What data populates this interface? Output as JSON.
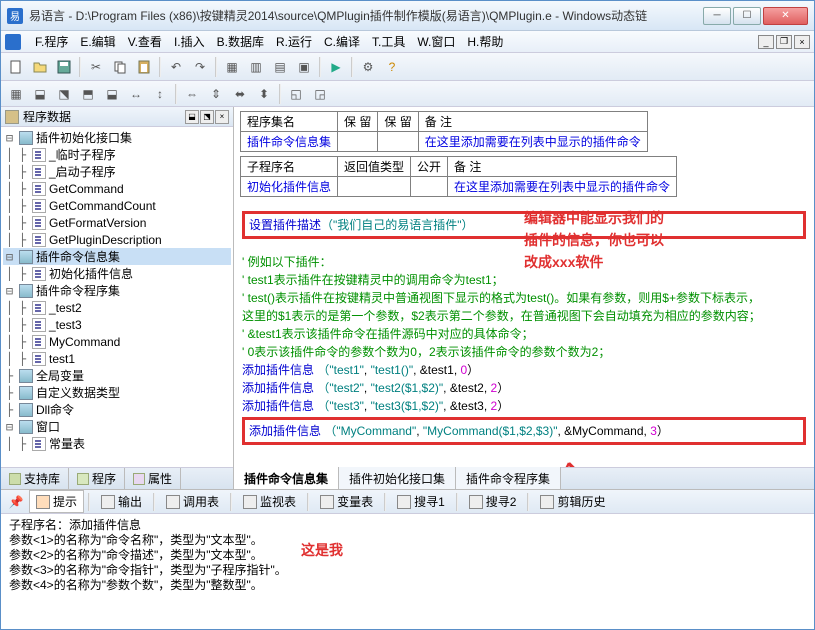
{
  "title": "易语言 - D:\\Program Files (x86)\\按键精灵2014\\source\\QMPlugin插件制作模版(易语言)\\QMPlugin.e - Windows动态链",
  "menu": [
    "F.程序",
    "E.编辑",
    "V.查看",
    "I.插入",
    "B.数据库",
    "R.运行",
    "C.编译",
    "T.工具",
    "W.窗口",
    "H.帮助"
  ],
  "leftHeader": "程序数据",
  "tree": [
    {
      "lvl": 0,
      "exp": "-",
      "icon": "mod",
      "label": "插件初始化接口集"
    },
    {
      "lvl": 1,
      "exp": "",
      "icon": "fn",
      "label": "_临时子程序"
    },
    {
      "lvl": 1,
      "exp": "",
      "icon": "fn",
      "label": "_启动子程序"
    },
    {
      "lvl": 1,
      "exp": "",
      "icon": "fn",
      "label": "GetCommand"
    },
    {
      "lvl": 1,
      "exp": "",
      "icon": "fn",
      "label": "GetCommandCount"
    },
    {
      "lvl": 1,
      "exp": "",
      "icon": "fn",
      "label": "GetFormatVersion"
    },
    {
      "lvl": 1,
      "exp": "",
      "icon": "fn",
      "label": "GetPluginDescription"
    },
    {
      "lvl": 0,
      "exp": "-",
      "icon": "mod",
      "label": "插件命令信息集",
      "sel": true
    },
    {
      "lvl": 1,
      "exp": "",
      "icon": "fn",
      "label": "初始化插件信息"
    },
    {
      "lvl": 0,
      "exp": "-",
      "icon": "mod",
      "label": "插件命令程序集"
    },
    {
      "lvl": 1,
      "exp": "",
      "icon": "fn",
      "label": "_test2"
    },
    {
      "lvl": 1,
      "exp": "",
      "icon": "fn",
      "label": "_test3"
    },
    {
      "lvl": 1,
      "exp": "",
      "icon": "fn",
      "label": "MyCommand"
    },
    {
      "lvl": 1,
      "exp": "",
      "icon": "fn",
      "label": "test1"
    },
    {
      "lvl": 0,
      "exp": "",
      "icon": "mod",
      "label": "全局变量"
    },
    {
      "lvl": 0,
      "exp": "",
      "icon": "mod",
      "label": "自定义数据类型"
    },
    {
      "lvl": 0,
      "exp": "",
      "icon": "mod",
      "label": "Dll命令"
    },
    {
      "lvl": 0,
      "exp": "-",
      "icon": "mod",
      "label": "窗口"
    },
    {
      "lvl": 1,
      "exp": "",
      "icon": "fn",
      "label": "常量表"
    }
  ],
  "leftTabs": [
    "支持库",
    "程序",
    "属性"
  ],
  "table1": {
    "headers": [
      "程序集名",
      "保 留",
      "保 留",
      "备 注"
    ],
    "row": [
      "插件命令信息集",
      "",
      "",
      "在这里添加需要在列表中显示的插件命令"
    ]
  },
  "table2": {
    "headers": [
      "子程序名",
      "返回值类型",
      "公开",
      "备 注"
    ],
    "row": [
      "初始化插件信息",
      "",
      "",
      "在这里添加需要在列表中显示的插件命令"
    ]
  },
  "code": {
    "setdesc_label": "设置插件描述",
    "setdesc_arg": "（\"我们自己的易语言插件\"）",
    "anno1": "编辑器中能显示我们的",
    "anno2": "插件的信息，你也可以",
    "anno3": "改成xxx软件",
    "c1": "'  例如以下插件：",
    "c2": "'  test1表示插件在按键精灵中的调用命令为test1；",
    "c3": "'  test()表示插件在按键精灵中普通视图下显示的格式为test()。如果有参数，则用$+参数下标表示，这里的$1表示的是第一个参数，$2表示第二个参数，在普通视图下会自动填充为相应的参数内容；",
    "c4": "'  &test1表示该插件命令在插件源码中对应的具体命令；",
    "c5": "'  0表示该插件命令的参数个数为0，2表示该插件命令的参数个数为2；",
    "l1a": "添加插件信息",
    "l1b": "（\"test1\"",
    "l1c": "\"test1()\"",
    "l1d": "&test1",
    "l1e": "0",
    "l1f": "）",
    "l2a": "添加插件信息",
    "l2b": "（\"test2\"",
    "l2c": "\"test2($1,$2)\"",
    "l2d": "&test2",
    "l2e": "2",
    "l2f": "）",
    "l3a": "添加插件信息",
    "l3b": "（\"test3\"",
    "l3c": "\"test3($1,$2)\"",
    "l3d": "&test3",
    "l3e": "2",
    "l3f": "）",
    "l4a": "添加插件信息",
    "l4b": "（\"MyCommand\"",
    "l4c": "\"MyCommand($1,$2,$3)\"",
    "l4d": "&MyCommand",
    "l4e": "3",
    "l4f": "）",
    "anno_bottom": "这是我"
  },
  "rightTabs": [
    "插件命令信息集",
    "插件初始化接口集",
    "插件命令程序集"
  ],
  "bottomTabs": [
    "提示",
    "输出",
    "调用表",
    "监视表",
    "变量表",
    "搜寻1",
    "搜寻2",
    "剪辑历史"
  ],
  "bottomText": "子程序名：添加插件信息\n参数<1>的名称为\"命令名称\"，类型为\"文本型\"。\n参数<2>的名称为\"命令描述\"，类型为\"文本型\"。\n参数<3>的名称为\"命令指针\"，类型为\"子程序指针\"。\n参数<4>的名称为\"参数个数\"，类型为\"整数型\"。"
}
